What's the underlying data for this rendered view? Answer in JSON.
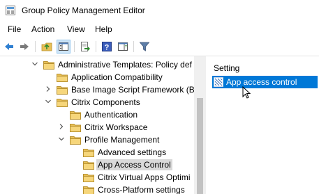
{
  "window": {
    "title": "Group Policy Management Editor"
  },
  "menu": {
    "items": [
      "File",
      "Action",
      "View",
      "Help"
    ]
  },
  "toolbar": {
    "buttons": [
      "back-arrow-icon",
      "forward-arrow-icon",
      "up-folder-icon",
      "show-hide-tree-icon",
      "export-list-icon",
      "help-icon",
      "properties-pane-icon",
      "filter-icon"
    ]
  },
  "tree": {
    "items": [
      {
        "label": "Administrative Templates: Policy def",
        "expanded": true,
        "selected": false
      },
      {
        "label": "Application Compatibility",
        "expanded": null,
        "selected": false
      },
      {
        "label": "Base Image Script Framework (BI",
        "expanded": false,
        "selected": false
      },
      {
        "label": "Citrix Components",
        "expanded": true,
        "selected": false
      },
      {
        "label": "Authentication",
        "expanded": null,
        "selected": false
      },
      {
        "label": "Citrix Workspace",
        "expanded": false,
        "selected": false
      },
      {
        "label": "Profile Management",
        "expanded": true,
        "selected": false
      },
      {
        "label": "Advanced settings",
        "expanded": null,
        "selected": false
      },
      {
        "label": "App Access Control",
        "expanded": null,
        "selected": true
      },
      {
        "label": "Citrix Virtual Apps Optimi",
        "expanded": null,
        "selected": false
      },
      {
        "label": "Cross-Platform settings",
        "expanded": null,
        "selected": false
      }
    ]
  },
  "details": {
    "column_header": "Setting",
    "rows": [
      {
        "label": "App access control",
        "selected": true
      }
    ]
  },
  "colors": {
    "selection": "#0078d7",
    "tree_selected": "#d9d9d9",
    "folder": "#e8c057"
  }
}
